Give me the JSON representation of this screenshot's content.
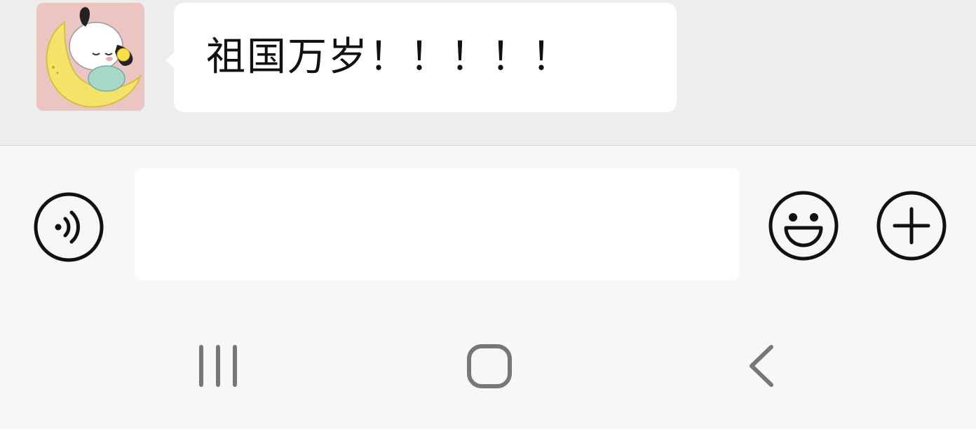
{
  "chat": {
    "message_text": "祖国万岁！！！！！",
    "bubble_color": "#ffffff",
    "background_color": "#ededed",
    "avatar_icon": "pochacco-moon-avatar"
  },
  "input_bar": {
    "voice_icon": "voice-icon",
    "input_value": "",
    "emoji_icon": "emoji-icon",
    "plus_icon": "plus-icon"
  },
  "nav_bar": {
    "recents_icon": "recents-icon",
    "home_icon": "home-icon",
    "back_icon": "back-icon"
  }
}
